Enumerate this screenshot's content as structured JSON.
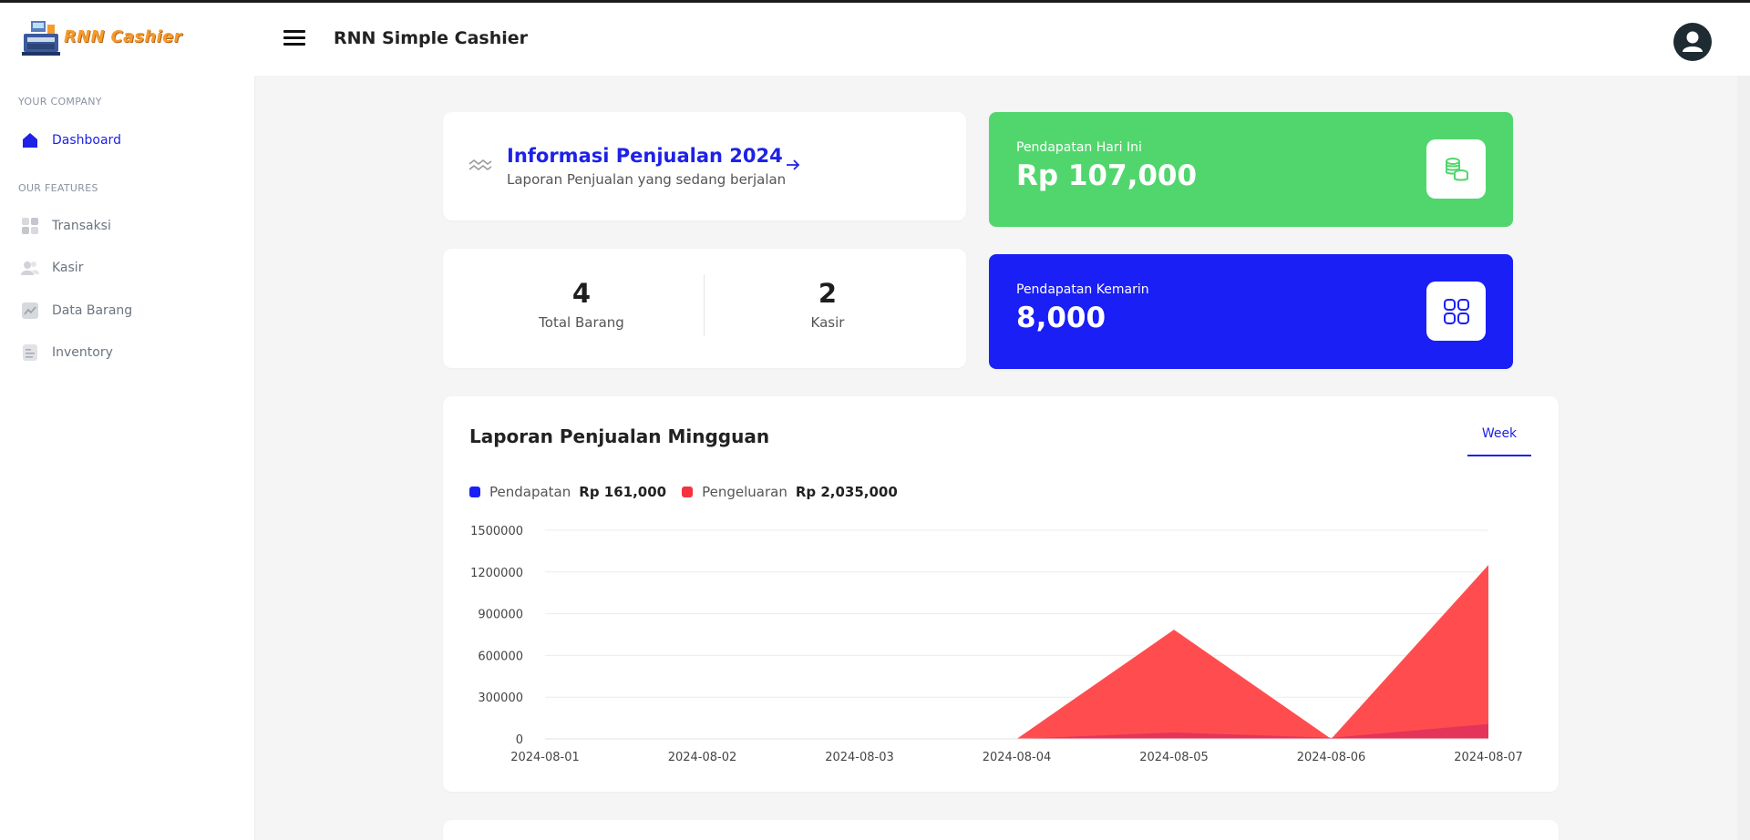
{
  "header": {
    "logo_text": "RNN Cashier",
    "app_title": "RNN Simple Cashier"
  },
  "sidebar": {
    "section_company": "YOUR COMPANY",
    "section_features": "OUR FEATURES",
    "items": [
      {
        "label": "Dashboard",
        "icon": "home-icon",
        "active": true
      },
      {
        "label": "Transaksi",
        "icon": "grid-icon",
        "active": false
      },
      {
        "label": "Kasir",
        "icon": "users-icon",
        "active": false
      },
      {
        "label": "Data Barang",
        "icon": "chart-icon",
        "active": false
      },
      {
        "label": "Inventory",
        "icon": "document-icon",
        "active": false
      }
    ]
  },
  "info_card": {
    "title": "Informasi Penjualan 2024",
    "subtitle": "Laporan Penjualan yang sedang berjalan"
  },
  "stats": {
    "total_barang_value": "4",
    "total_barang_label": "Total Barang",
    "kasir_value": "2",
    "kasir_label": "Kasir"
  },
  "kpi": {
    "today_label": "Pendapatan Hari Ini",
    "today_value": "Rp 107,000",
    "yesterday_label": "Pendapatan Kemarin",
    "yesterday_value": "8,000"
  },
  "colors": {
    "accent": "#1e22e6",
    "green": "#51d66d",
    "blue": "#1a1ff5",
    "revenue": "#1a1ff5",
    "expense": "#ff4d4f"
  },
  "chart_section": {
    "title": "Laporan Penjualan Mingguan",
    "tab": "Week",
    "legend": [
      {
        "name": "Pendapatan",
        "amount": "Rp 161,000",
        "color": "#1a1ff5"
      },
      {
        "name": "Pengeluaran",
        "amount": "Rp 2,035,000",
        "color": "#f5333f"
      }
    ]
  },
  "chart_data": {
    "type": "area",
    "x": [
      "2024-08-01",
      "2024-08-02",
      "2024-08-03",
      "2024-08-04",
      "2024-08-05",
      "2024-08-06",
      "2024-08-07"
    ],
    "y_ticks": [
      "0",
      "300000",
      "600000",
      "900000",
      "1200000",
      "1500000"
    ],
    "ylim": [
      0,
      1500000
    ],
    "series": [
      {
        "name": "Pengeluaran",
        "values": [
          0,
          0,
          0,
          0,
          785000,
          0,
          1250000
        ]
      },
      {
        "name": "Pendapatan",
        "values": [
          0,
          0,
          0,
          0,
          46000,
          8000,
          107000
        ]
      }
    ],
    "grid": true
  }
}
